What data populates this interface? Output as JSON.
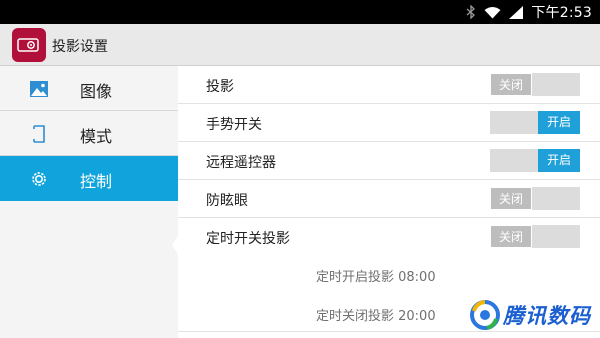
{
  "status_bar": {
    "time": "下午2:53"
  },
  "header": {
    "title": "投影设置"
  },
  "sidebar": {
    "items": [
      {
        "label": "图像",
        "icon": "image-icon"
      },
      {
        "label": "模式",
        "icon": "mode-icon"
      },
      {
        "label": "控制",
        "icon": "gear-icon",
        "active": true
      }
    ]
  },
  "settings": {
    "rows": [
      {
        "label": "投影",
        "toggle": "关闭",
        "state": "off"
      },
      {
        "label": "手势开关",
        "toggle": "开启",
        "state": "on"
      },
      {
        "label": "远程遥控器",
        "toggle": "开启",
        "state": "on"
      },
      {
        "label": "防眩眼",
        "toggle": "关闭",
        "state": "off"
      },
      {
        "label": "定时开关投影",
        "toggle": "关闭",
        "state": "off"
      }
    ],
    "schedule_on": "定时开启投影 08:00",
    "schedule_off": "定时关闭投影 20:00"
  },
  "watermark": {
    "text": "腾讯数码"
  },
  "colors": {
    "accent": "#11a4dc",
    "toggle_on": "#1fa0d8",
    "app_icon": "#b0103a"
  }
}
